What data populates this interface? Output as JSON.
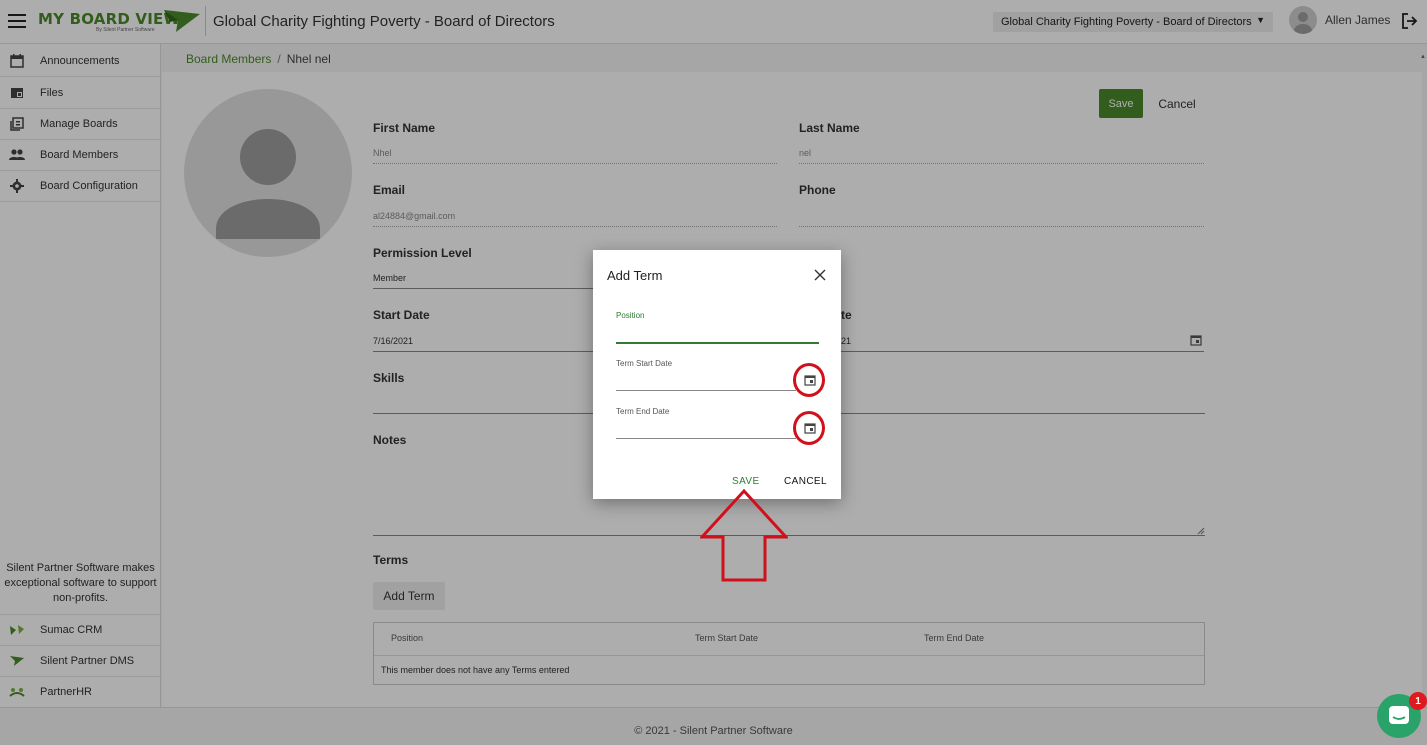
{
  "app": {
    "logo_text": "MY BOARD VIEW",
    "logo_subtext": "By Silent Partner Software",
    "title": "Global Charity Fighting Poverty - Board of Directors",
    "board_selector": "Global Charity Fighting Poverty - Board of Directors",
    "user_name": "Allen James"
  },
  "sidebar": {
    "items": [
      {
        "label": "Announcements",
        "icon": "calendar-icon"
      },
      {
        "label": "Files",
        "icon": "folder-icon"
      },
      {
        "label": "Manage Boards",
        "icon": "boards-icon"
      },
      {
        "label": "Board Members",
        "icon": "people-icon"
      },
      {
        "label": "Board Configuration",
        "icon": "gear-icon"
      }
    ],
    "blurb": "Silent Partner Software makes exceptional software to support non-profits.",
    "products": [
      {
        "label": "Sumac CRM",
        "icon": "sumac-icon"
      },
      {
        "label": "Silent Partner DMS",
        "icon": "dms-icon"
      },
      {
        "label": "PartnerHR",
        "icon": "partnerhr-icon"
      }
    ]
  },
  "breadcrumb": {
    "parent": "Board Members",
    "separator": "/",
    "current": "Nhel nel"
  },
  "form": {
    "save_label": "Save",
    "cancel_label": "Cancel",
    "first_name_label": "First Name",
    "first_name_value": "Nhel",
    "last_name_label": "Last Name",
    "last_name_value": "nel",
    "email_label": "Email",
    "email_value": "al24884@gmail.com",
    "phone_label": "Phone",
    "phone_value": "",
    "permission_label": "Permission Level",
    "permission_value": "Member",
    "start_date_label": "Start Date",
    "start_date_value": "7/16/2021",
    "end_date_label_partial": "te",
    "end_date_value_partial": "21",
    "skills_label": "Skills",
    "notes_label": "Notes",
    "terms_label": "Terms",
    "add_term_label": "Add Term",
    "terms_table": {
      "headers": [
        "Position",
        "Term Start Date",
        "Term End Date"
      ],
      "empty_message": "This member does not have any Terms entered"
    }
  },
  "dialog": {
    "title": "Add Term",
    "position_label": "Position",
    "term_start_label": "Term Start Date",
    "term_end_label": "Term End Date",
    "save_label": "SAVE",
    "cancel_label": "CANCEL"
  },
  "footer": {
    "text": "© 2021 - Silent Partner Software"
  },
  "chat": {
    "badge_count": "1"
  },
  "colors": {
    "brand_green": "#4a8a2a",
    "active_green": "#2e7d32",
    "annotation_red": "#d0101b"
  }
}
